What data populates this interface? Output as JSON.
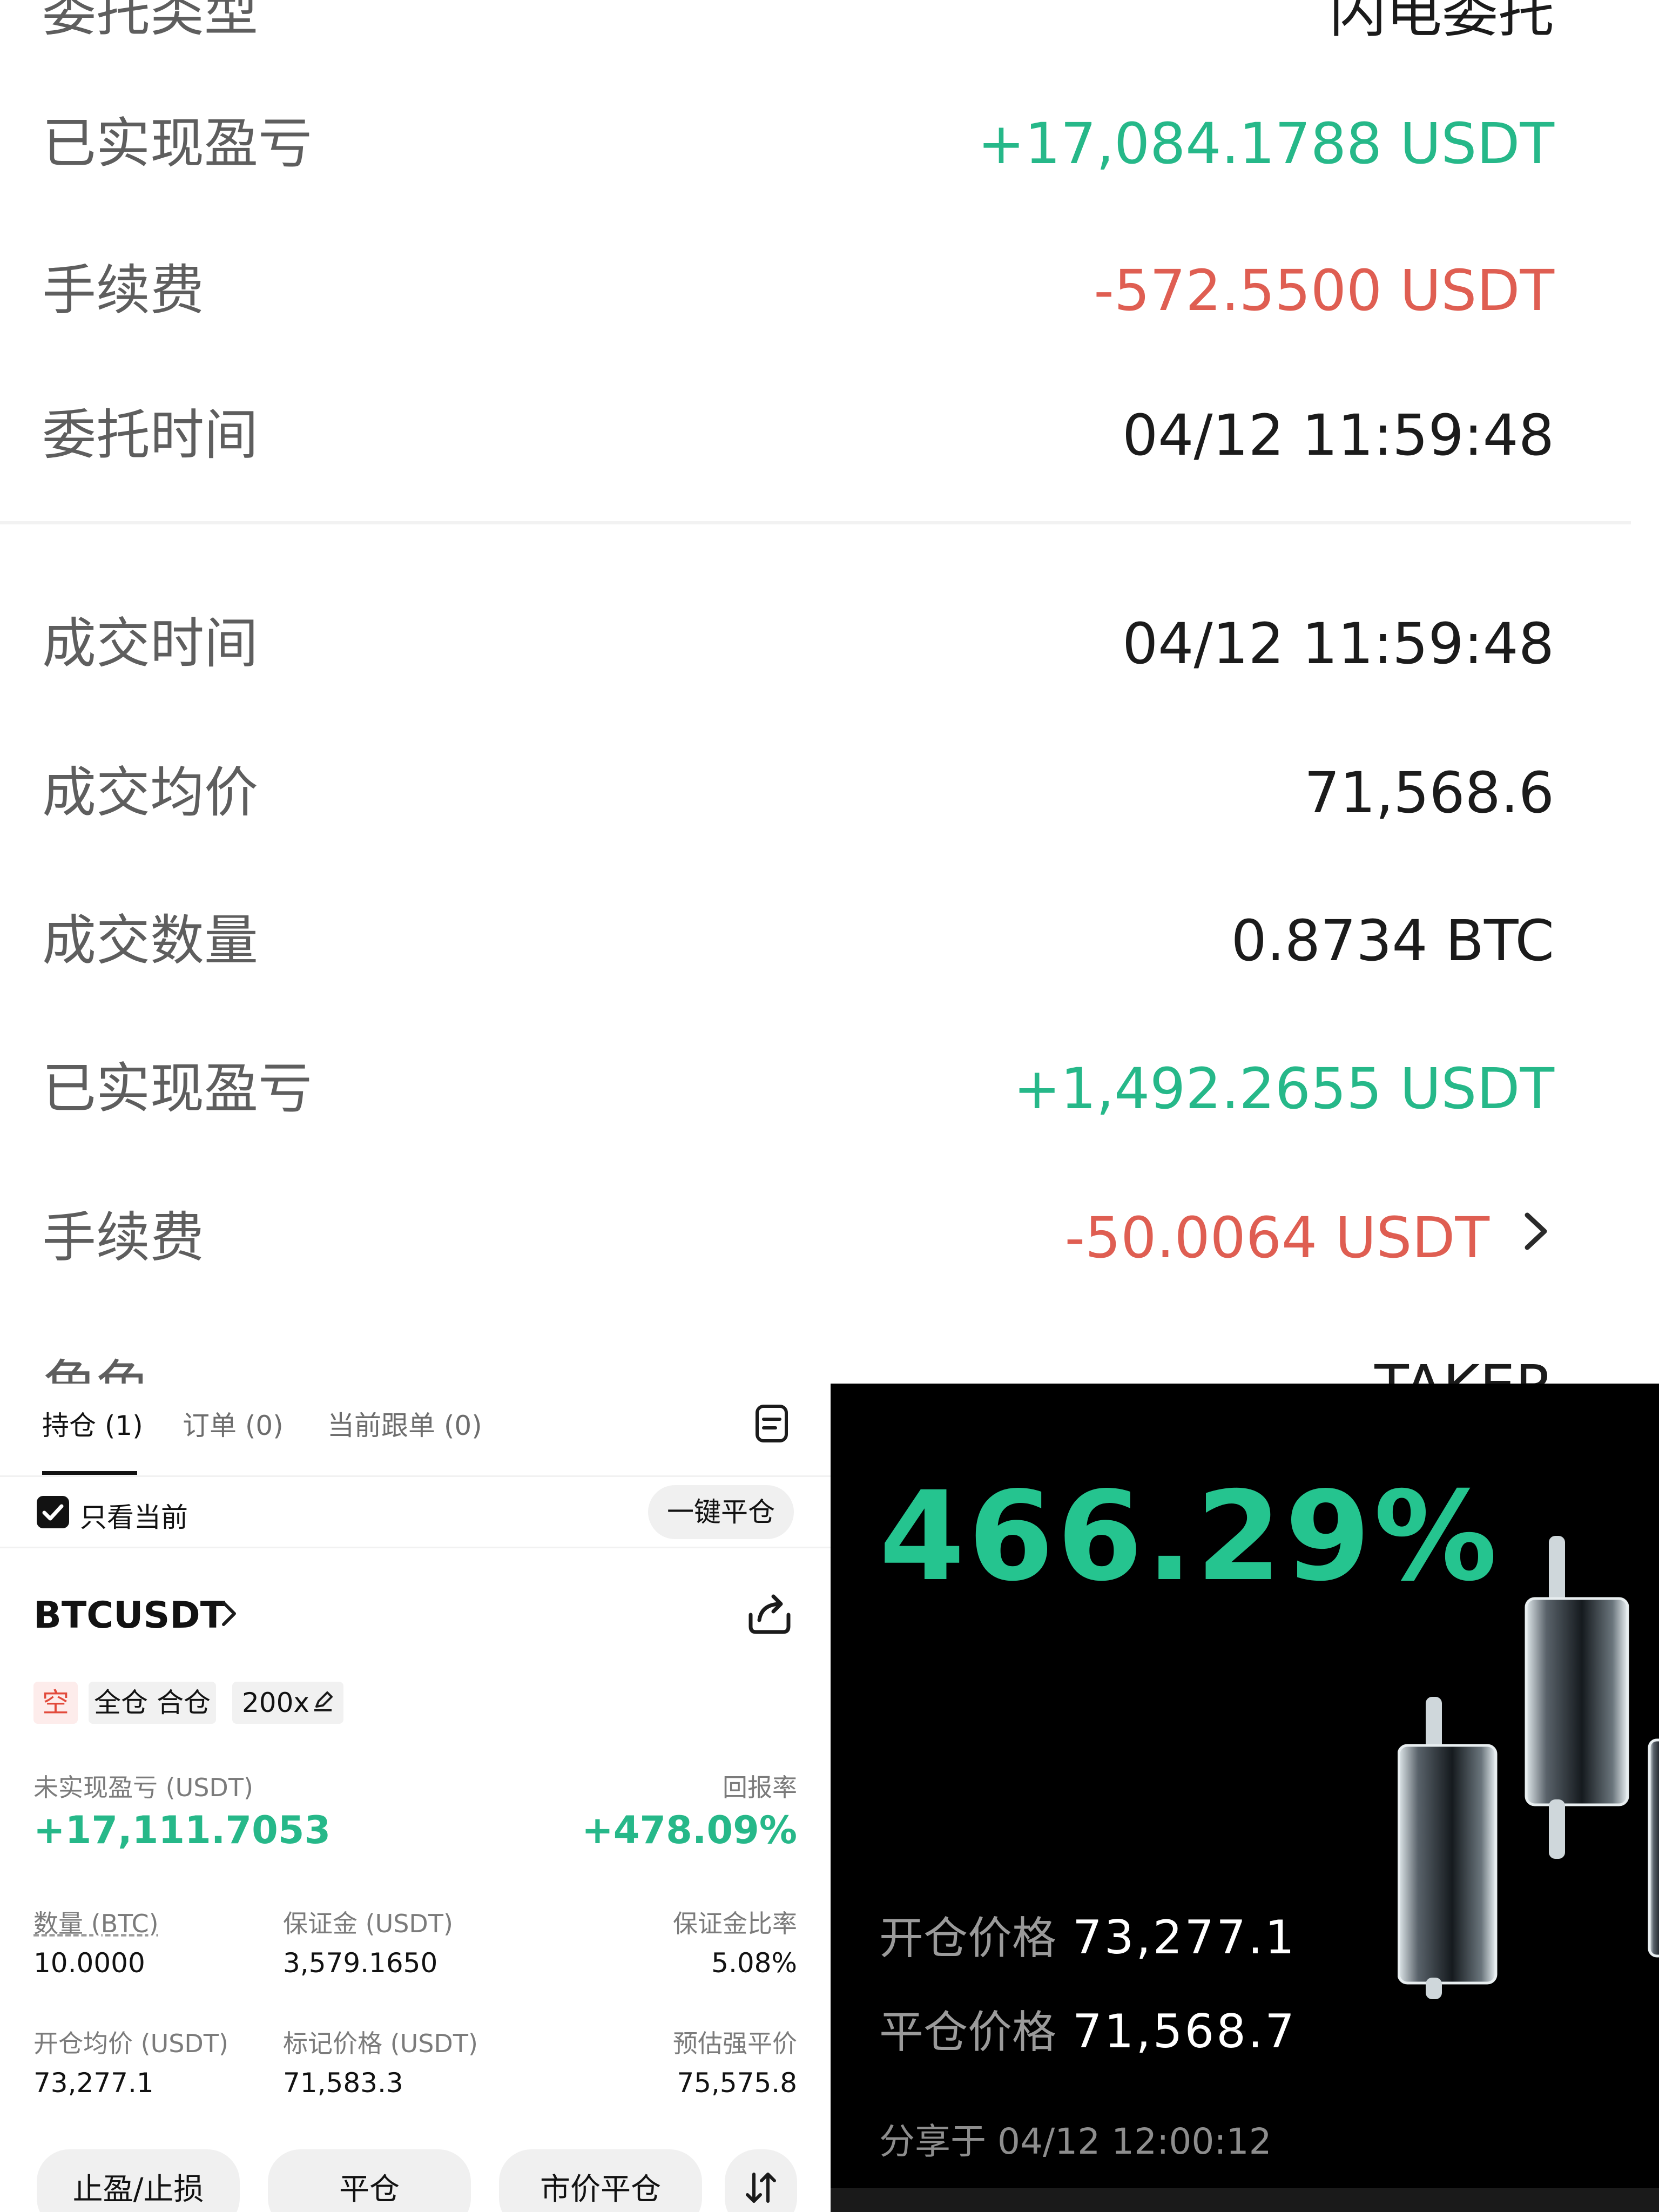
{
  "detail": {
    "order_type": {
      "label": "委托类型",
      "value": "闪电委托"
    },
    "realized_pnl_1": {
      "label": "已实现盈亏",
      "value": "+17,084.1788 USDT"
    },
    "fee_1": {
      "label": "手续费",
      "value": "-572.5500 USDT"
    },
    "order_time": {
      "label": "委托时间",
      "value": "04/12 11:59:48"
    },
    "fill_time": {
      "label": "成交时间",
      "value": "04/12 11:59:48"
    },
    "avg_price": {
      "label": "成交均价",
      "value": "71,568.6"
    },
    "fill_qty": {
      "label": "成交数量",
      "value": "0.8734 BTC"
    },
    "realized_pnl_2": {
      "label": "已实现盈亏",
      "value": "+1,492.2655 USDT"
    },
    "fee_2": {
      "label": "手续费",
      "value": "-50.0064 USDT"
    },
    "role": {
      "label": "角色",
      "value": "TAKER"
    }
  },
  "positions": {
    "tabs": [
      "持仓 (1)",
      "订单 (0)",
      "当前跟单 (0)"
    ],
    "filter_label": "只看当前",
    "close_all_label": "一键平仓",
    "symbol": "BTCUSDT",
    "tags": [
      "空",
      "全仓 合仓",
      "200x"
    ],
    "unrealized_label": "未实现盈亏 (USDT)",
    "unrealized_value": "+17,111.7053",
    "roe_label": "回报率",
    "roe_value": "+478.09%",
    "qty_label": "数量 (BTC)",
    "qty_value": "10.0000",
    "margin_label": "保证金 (USDT)",
    "margin_value": "3,579.1650",
    "margin_ratio_label": "保证金比率",
    "margin_ratio_value": "5.08%",
    "entry_label": "开仓均价 (USDT)",
    "entry_value": "73,277.1",
    "mark_label": "标记价格 (USDT)",
    "mark_value": "71,583.3",
    "liq_label": "预估强平价",
    "liq_value": "75,575.8",
    "buttons": [
      "止盈/止损",
      "平仓",
      "市价平仓"
    ]
  },
  "share_card": {
    "roe": "466.29%",
    "open_label": "开仓价格",
    "open_value": "73,277.1",
    "close_label": "平仓价格",
    "close_value": "71,568.7",
    "shared_at": "分享于 04/12 12:00:12"
  },
  "colors": {
    "green": "#26b889",
    "red": "#df5e52",
    "card_green": "#25c48f"
  },
  "icons": [
    "chevron-right-icon",
    "notes-icon",
    "checkbox-checked-icon",
    "share-icon",
    "edit-icon",
    "swap-icon",
    "candlestick-illustration"
  ]
}
